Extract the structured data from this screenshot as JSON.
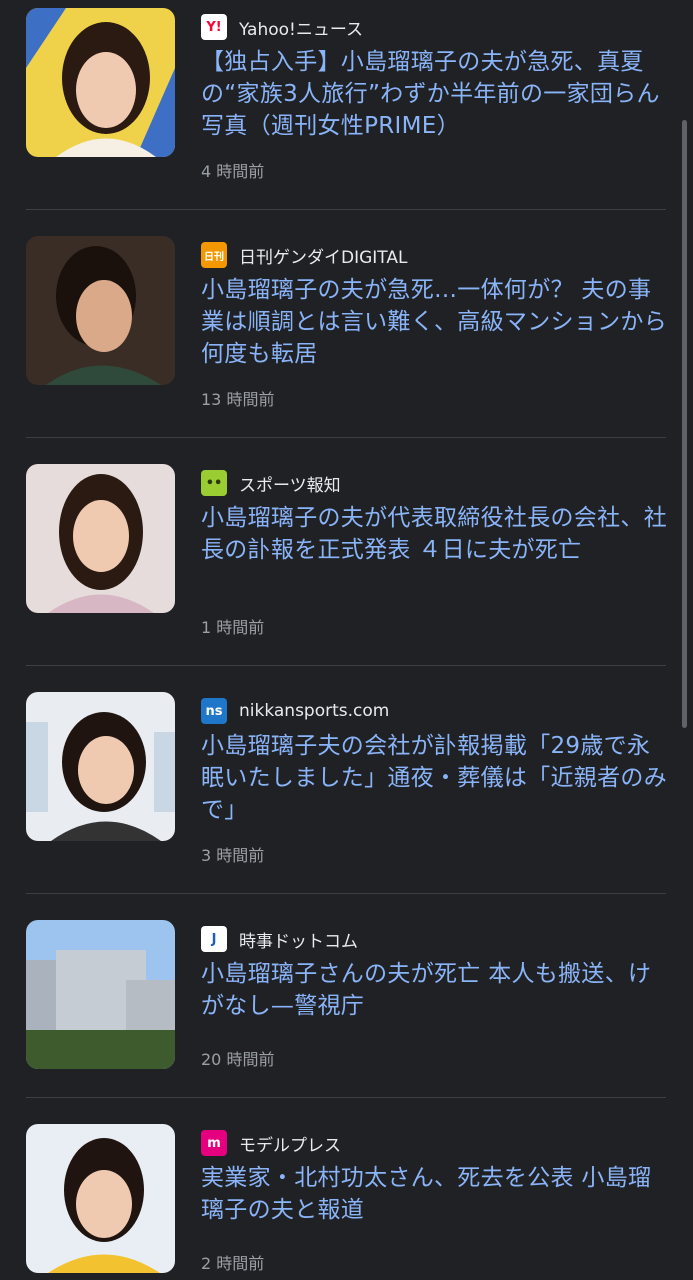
{
  "articles": [
    {
      "source": "Yahoo!ニュース",
      "logo_text": "Y!",
      "logo_bg": "#ffffff",
      "logo_fg": "#ff0033",
      "title": "【独占入手】小島瑠璃子の夫が急死、真夏の“家族3人旅行”わずか半年前の一家団らん写真（週刊女性PRIME）",
      "time": "4 時間前"
    },
    {
      "source": "日刊ゲンダイDIGITAL",
      "logo_text": "日刊",
      "logo_bg": "#f39800",
      "logo_fg": "#ffffff",
      "title": "小島瑠璃子の夫が急死…一体何が？ 夫の事業は順調とは言い難く、高級マンションから何度も転居",
      "time": "13 時間前"
    },
    {
      "source": "スポーツ報知",
      "logo_text": "••",
      "logo_bg": "#9acd32",
      "logo_fg": "#2b3a0a",
      "title": "小島瑠璃子の夫が代表取締役社長の会社、社長の訃報を正式発表 ４日に夫が死亡",
      "time": "1 時間前"
    },
    {
      "source": "nikkansports.com",
      "logo_text": "ns",
      "logo_bg": "#1f77c9",
      "logo_fg": "#ffffff",
      "title": "小島瑠璃子夫の会社が訃報掲載「29歳で永眠いたしました」通夜・葬儀は「近親者のみで」",
      "time": "3 時間前"
    },
    {
      "source": "時事ドットコム",
      "logo_text": "J",
      "logo_bg": "#ffffff",
      "logo_fg": "#1a5fb4",
      "title": "小島瑠璃子さんの夫が死亡 本人も搬送、けがなし—警視庁",
      "time": "20 時間前"
    },
    {
      "source": "モデルプレス",
      "logo_text": "m",
      "logo_bg": "#e4007f",
      "logo_fg": "#ffffff",
      "title": "実業家・北村功太さん、死去を公表 小島瑠璃子の夫と報道",
      "time": "2 時間前"
    }
  ]
}
